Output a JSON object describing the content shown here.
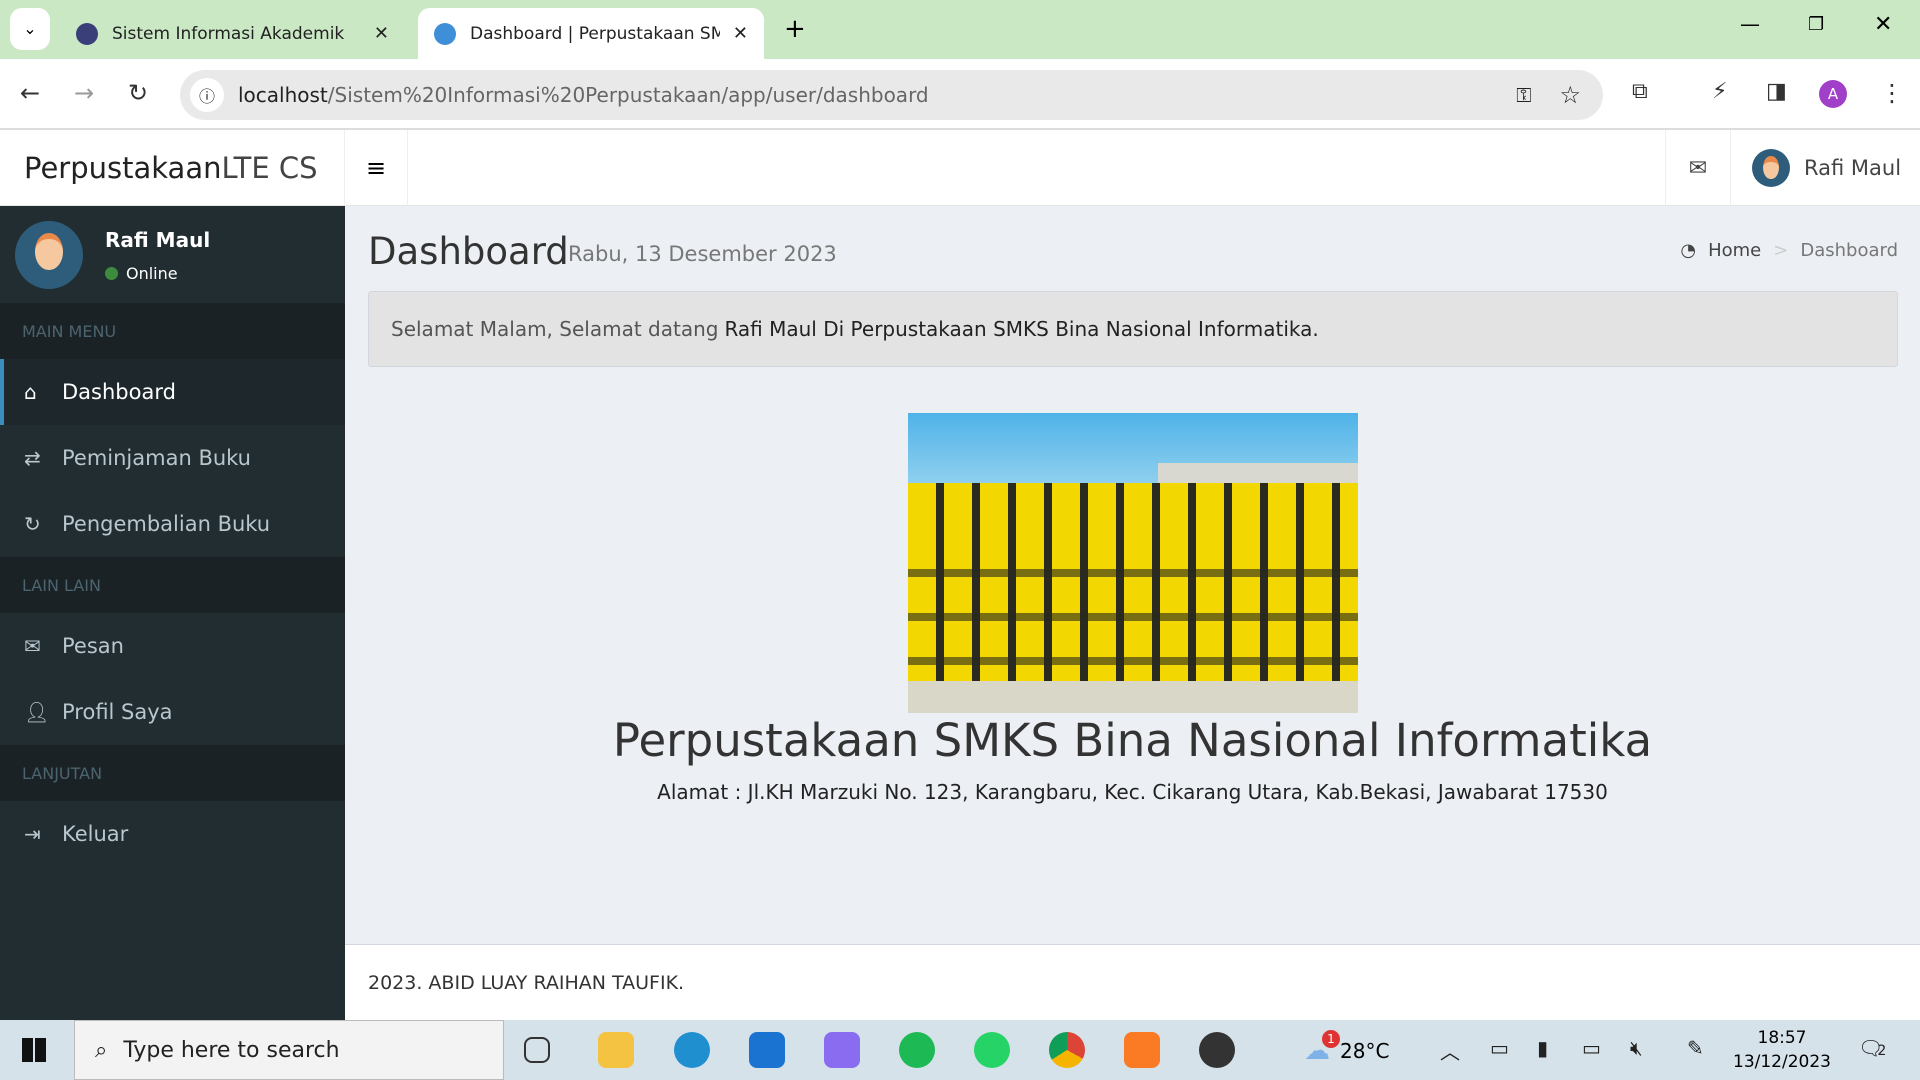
{
  "browser": {
    "tabs": [
      {
        "title": "Sistem Informasi Akademik",
        "active": false
      },
      {
        "title": "Dashboard | Perpustakaan SMK",
        "active": true
      }
    ],
    "url_host": "localhost",
    "url_path": "/Sistem%20Informasi%20Perpustakaan/app/user/dashboard",
    "profile_initial": "A"
  },
  "header": {
    "brand_bold": "Perpustakaan",
    "brand_light": " LTE CS",
    "user": "Rafi Maul"
  },
  "sidebar": {
    "user": {
      "name": "Rafi Maul",
      "status": "Online"
    },
    "sections": [
      "MAIN MENU",
      "LAIN LAIN",
      "LANJUTAN"
    ],
    "items": [
      {
        "label": "Dashboard",
        "icon": "home-icon",
        "active": true
      },
      {
        "label": "Peminjaman Buku",
        "icon": "exchange-icon"
      },
      {
        "label": "Pengembalian Buku",
        "icon": "refresh-icon"
      },
      {
        "label": "Pesan",
        "icon": "envelope-icon"
      },
      {
        "label": "Profil Saya",
        "icon": "user-icon"
      },
      {
        "label": "Keluar",
        "icon": "sign-out-icon"
      }
    ]
  },
  "main": {
    "title": "Dashboard",
    "date": "Rabu, 13 Desember 2023",
    "breadcrumb": [
      "Home",
      "Dashboard"
    ],
    "greeting": "Selamat Malam, Selamat datang",
    "greeting_bold": "Rafi Maul Di Perpustakaan SMKS Bina Nasional Informatika.",
    "library_name": "Perpustakaan SMKS Bina Nasional Informatika",
    "address": "Alamat : Jl.KH Marzuki No. 123, Karangbaru, Kec. Cikarang Utara, Kab.Bekasi, Jawabarat 17530"
  },
  "footer": "2023. ABID LUAY RAIHAN TAUFIK.",
  "taskbar": {
    "search_placeholder": "Type here to search",
    "weather": "28°C",
    "weather_badge": "1",
    "time": "18:57",
    "date": "13/12/2023",
    "notifications": "2"
  }
}
